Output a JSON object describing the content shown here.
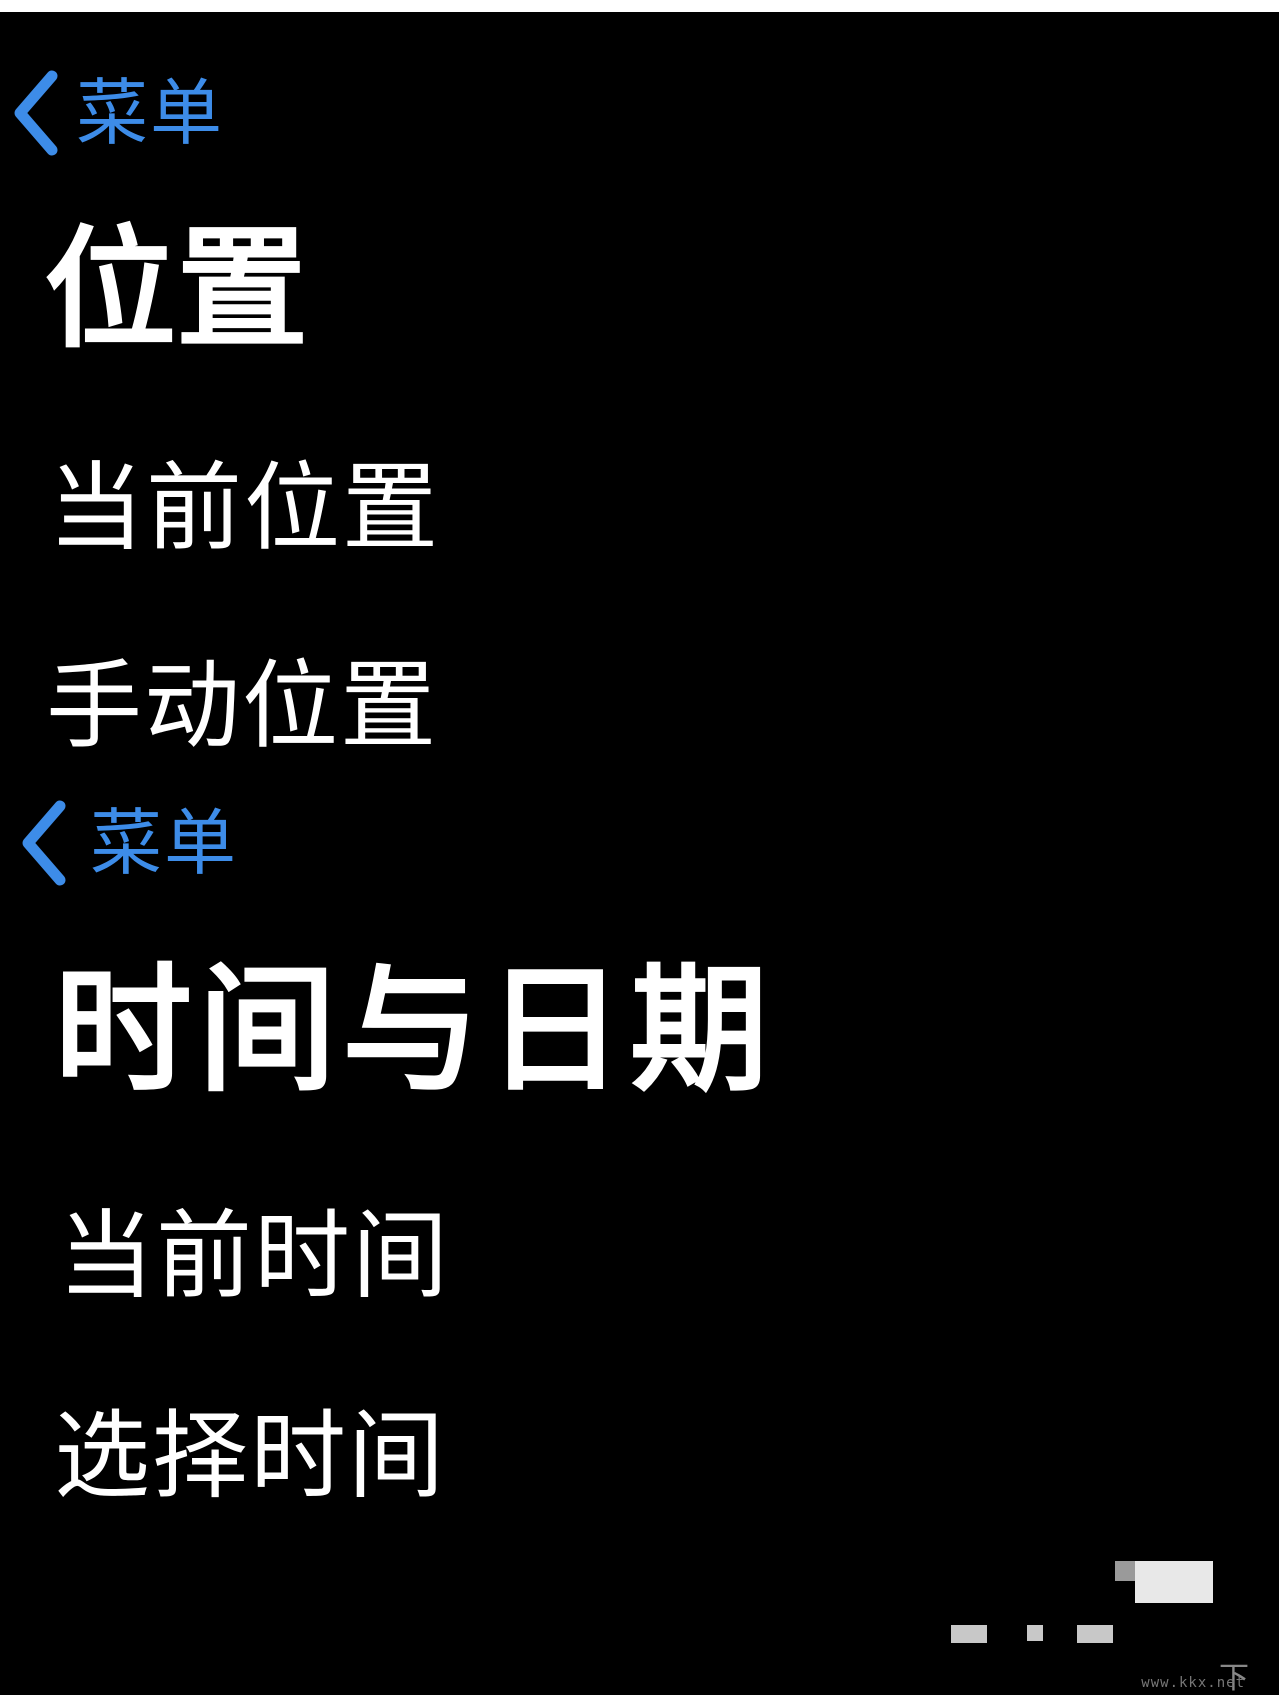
{
  "location_screen": {
    "back_label": "菜单",
    "title": "位置",
    "items": [
      {
        "label": "当前位置"
      },
      {
        "label": "手动位置"
      }
    ]
  },
  "datetime_screen": {
    "back_label": "菜单",
    "title": "时间与日期",
    "items": [
      {
        "label": "当前时间"
      },
      {
        "label": "选择时间"
      }
    ]
  },
  "watermark": {
    "site": "www.kkx.net",
    "logo_text": "下载"
  },
  "colors": {
    "background": "#000000",
    "accent": "#3d8ce8",
    "text": "#ffffff"
  },
  "icons": {
    "back": "chevron-left-icon"
  }
}
